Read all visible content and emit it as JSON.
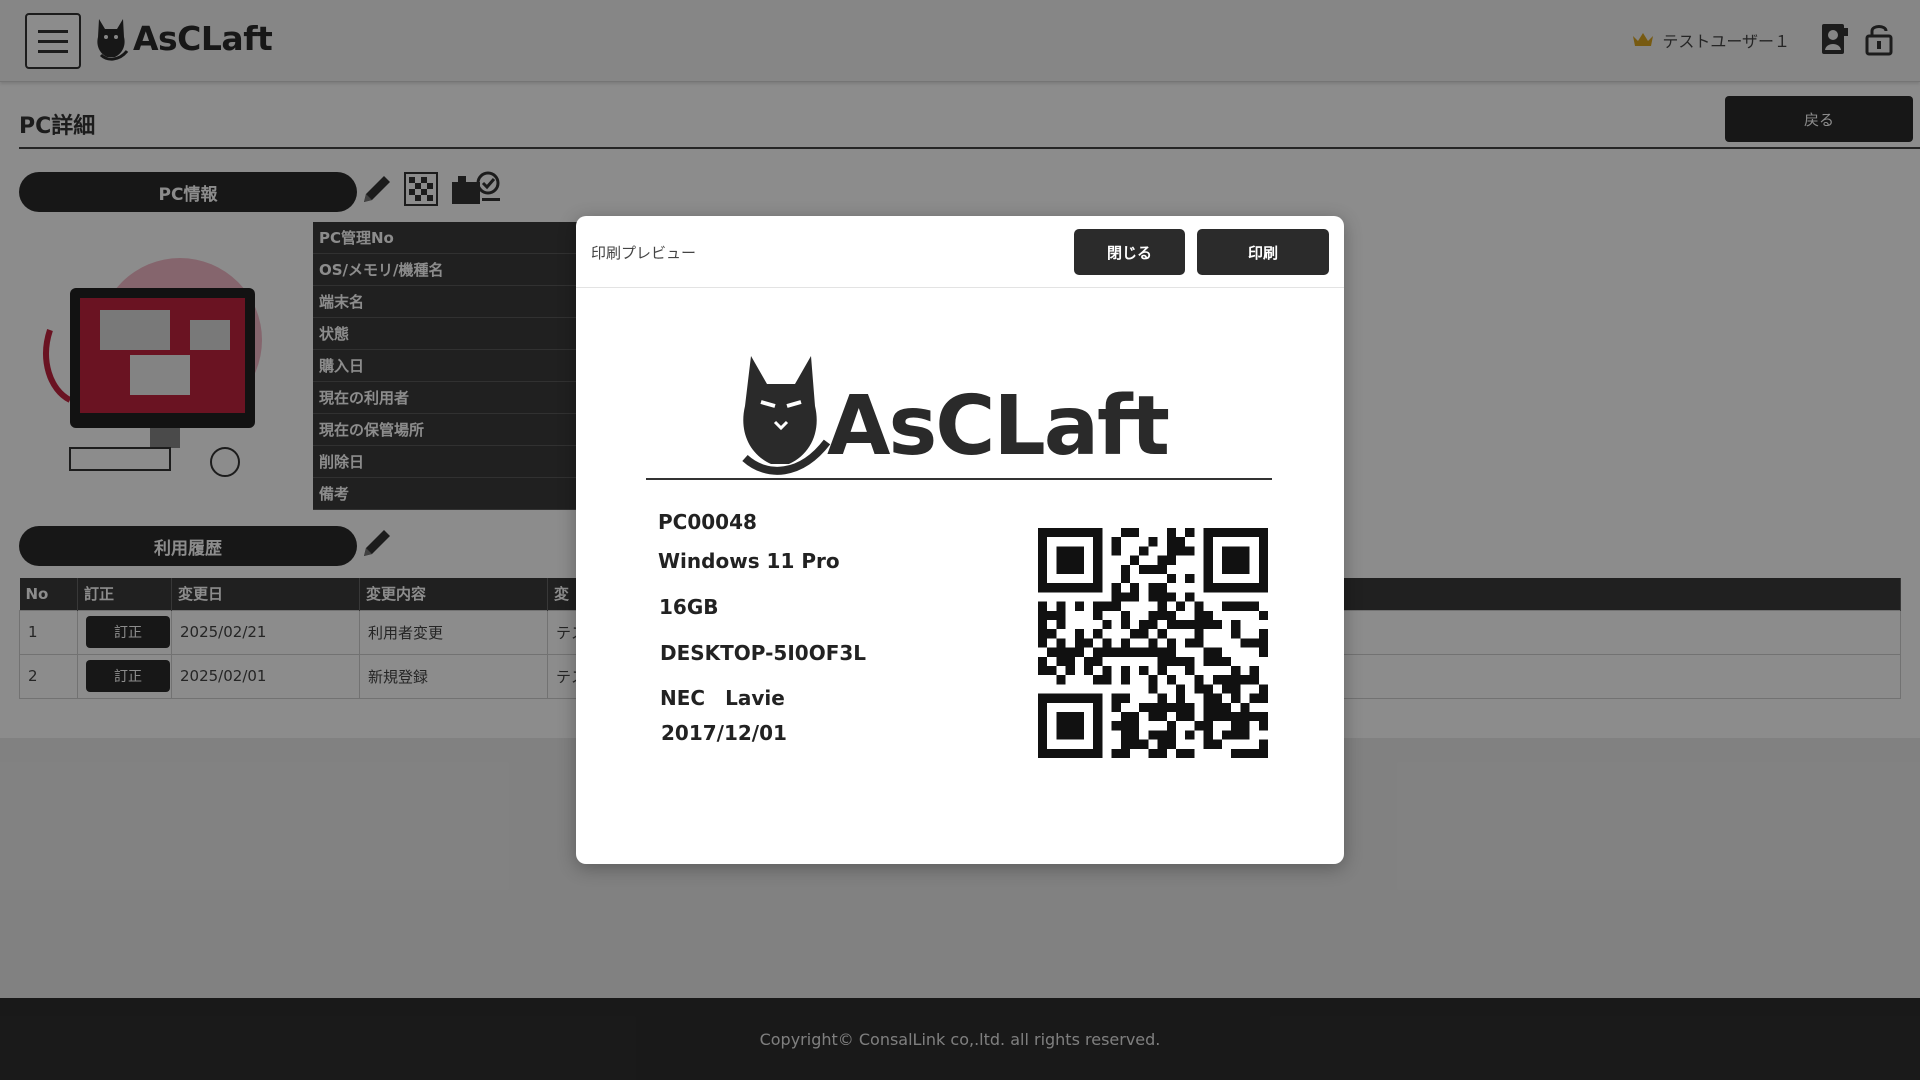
{
  "header": {
    "brand": "AsCLaft",
    "user_name": "テストユーザー１"
  },
  "page": {
    "title": "PC詳細",
    "back_label": "戻る"
  },
  "pc_info": {
    "section_label": "PC情報",
    "fields": [
      "PC管理No",
      "OS/メモリ/機種名",
      "端末名",
      "状態",
      "購入日",
      "現在の利用者",
      "現在の保管場所",
      "削除日",
      "備考"
    ]
  },
  "history": {
    "section_label": "利用履歴",
    "columns": [
      "No",
      "訂正",
      "変更日",
      "変更内容",
      "変"
    ],
    "rows": [
      {
        "no": "1",
        "fix": "訂正",
        "date": "2025/02/21",
        "content": "利用者変更",
        "partial": "テス"
      },
      {
        "no": "2",
        "fix": "訂正",
        "date": "2025/02/01",
        "content": "新規登録",
        "partial": "テス"
      }
    ]
  },
  "footer": {
    "copyright": "Copyright© ConsalLink co,.ltd. all rights reserved."
  },
  "modal": {
    "title": "印刷プレビュー",
    "close_label": "閉じる",
    "print_label": "印刷",
    "label": {
      "brand": "AsCLaft",
      "pc_no": "PC00048",
      "os": "Windows 11 Pro",
      "memory": "16GB",
      "hostname": "DESKTOP-5I0OF3L",
      "model": "NEC　Lavie",
      "purchase_date": "2017/12/01"
    }
  }
}
